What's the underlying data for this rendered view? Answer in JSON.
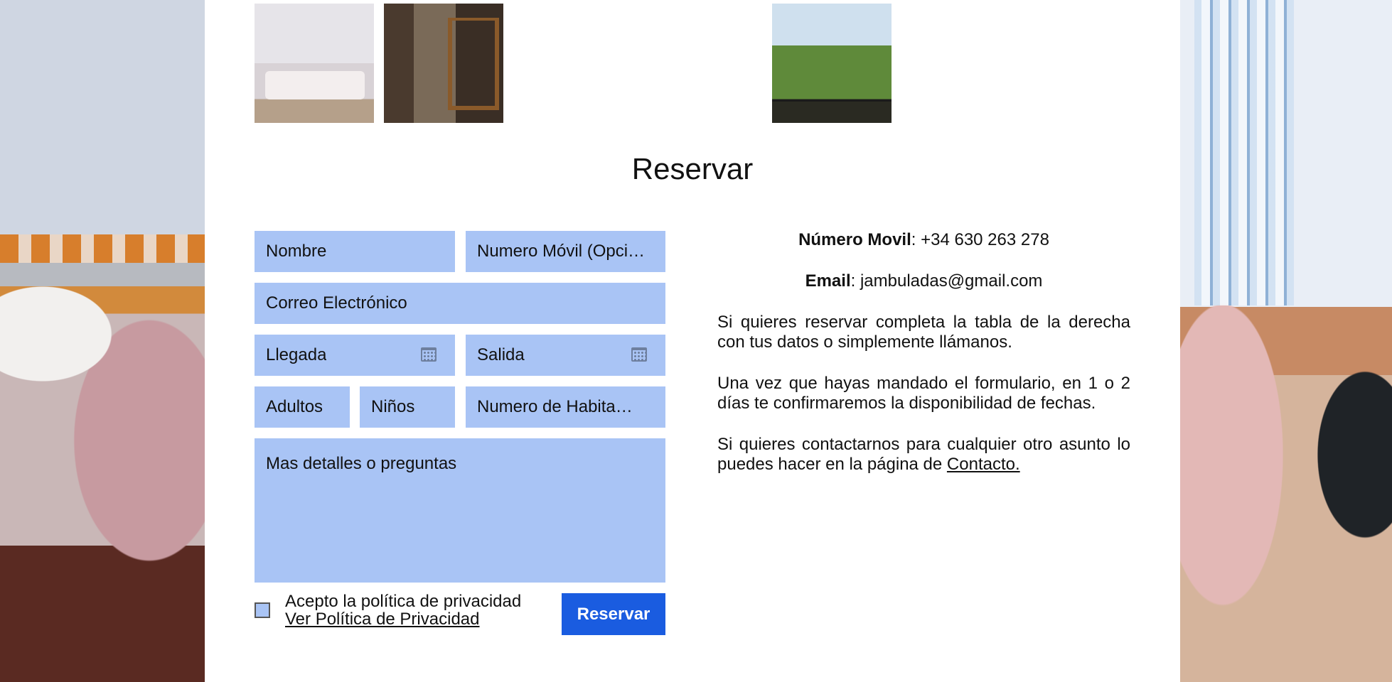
{
  "title": "Reservar",
  "form": {
    "name_placeholder": "Nombre",
    "mobile_placeholder": "Numero Móvil (Opci…",
    "email_placeholder": "Correo Electrónico",
    "arrival_placeholder": "Llegada",
    "departure_placeholder": "Salida",
    "adults_placeholder": "Adultos",
    "children_placeholder": "Niños",
    "rooms_placeholder": "Numero de Habita…",
    "details_placeholder": "Mas detalles o preguntas",
    "privacy_label": "Acepto la política de privacidad",
    "privacy_link": "Ver Política de Privacidad",
    "submit_label": "Reservar"
  },
  "info": {
    "mobile_label": "Número Movil",
    "mobile_value": ": +34 630 263 278",
    "email_label": "Email",
    "email_value": ": jambuladas@gmail.com",
    "paragraph1": "Si quieres reservar completa la tabla de la derecha con tus datos o simplemente llámanos.",
    "paragraph2": "Una vez que hayas mandado el formulario, en 1 o 2 días te confirmaremos la disponibilidad de fechas.",
    "paragraph3_text": "Si quieres contactarnos para cualquier otro asunto lo puedes hacer en la página de ",
    "contact_link": "Contacto."
  },
  "colors": {
    "field_bg": "#a9c4f5",
    "button_bg": "#1a5ce0"
  }
}
